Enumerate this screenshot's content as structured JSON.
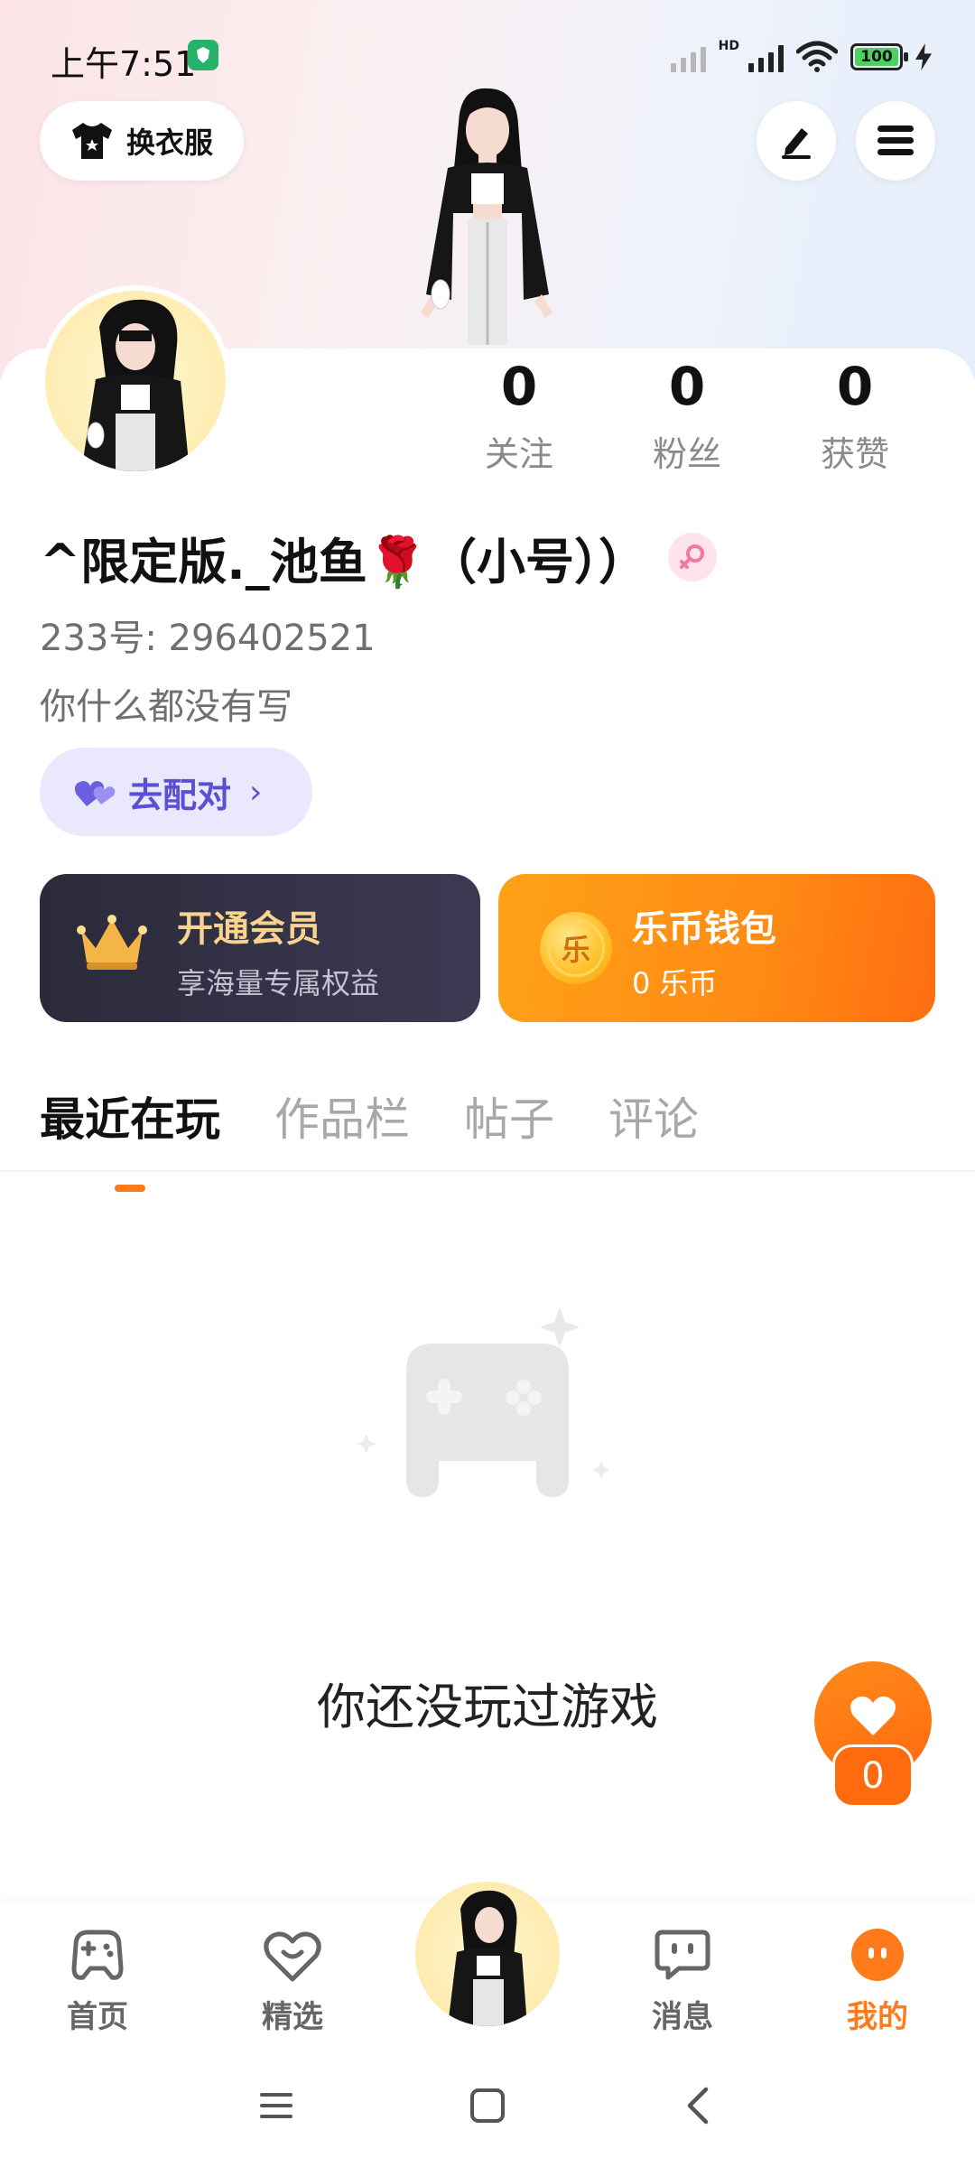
{
  "status_bar": {
    "time": "上午7:51",
    "network_label": "HD",
    "battery": "100",
    "colors": {
      "shield": "#25b36b",
      "battery_fill": "#4fd161"
    }
  },
  "header": {
    "dress_up_label": "换衣服",
    "icons": [
      "tshirt-icon",
      "edit-icon",
      "menu-icon"
    ]
  },
  "profile": {
    "stats": [
      {
        "value": "0",
        "label": "关注"
      },
      {
        "value": "0",
        "label": "粉丝"
      },
      {
        "value": "0",
        "label": "获赞"
      }
    ],
    "nickname": "^限定版._池鱼🌹（小号））",
    "uid": "233号: 296402521",
    "bio": "你什么都没有写",
    "match_label": "去配对"
  },
  "cards": {
    "vip": {
      "title": "开通会员",
      "subtitle": "享海量专属权益"
    },
    "wallet": {
      "title": "乐币钱包",
      "subtitle": "0 乐币",
      "coin_glyph": "乐"
    }
  },
  "tabs": [
    {
      "label": "最近在玩",
      "active": true
    },
    {
      "label": "作品栏",
      "active": false
    },
    {
      "label": "帖子",
      "active": false
    },
    {
      "label": "评论",
      "active": false
    }
  ],
  "empty_state": {
    "text": "你还没玩过游戏"
  },
  "like_fab": {
    "count": "0"
  },
  "bottom_nav": [
    {
      "label": "首页",
      "icon": "gamepad-icon",
      "active": false
    },
    {
      "label": "精选",
      "icon": "heart-smile-icon",
      "active": false
    },
    {
      "label": "",
      "icon": "avatar",
      "active": false
    },
    {
      "label": "消息",
      "icon": "chat-icon",
      "active": false
    },
    {
      "label": "我的",
      "icon": "profile-face-icon",
      "active": true
    }
  ],
  "theme": {
    "accent": "#ff7a1a",
    "match_purple": "#5b4fd3",
    "vip_gold": "#f7d38d"
  }
}
